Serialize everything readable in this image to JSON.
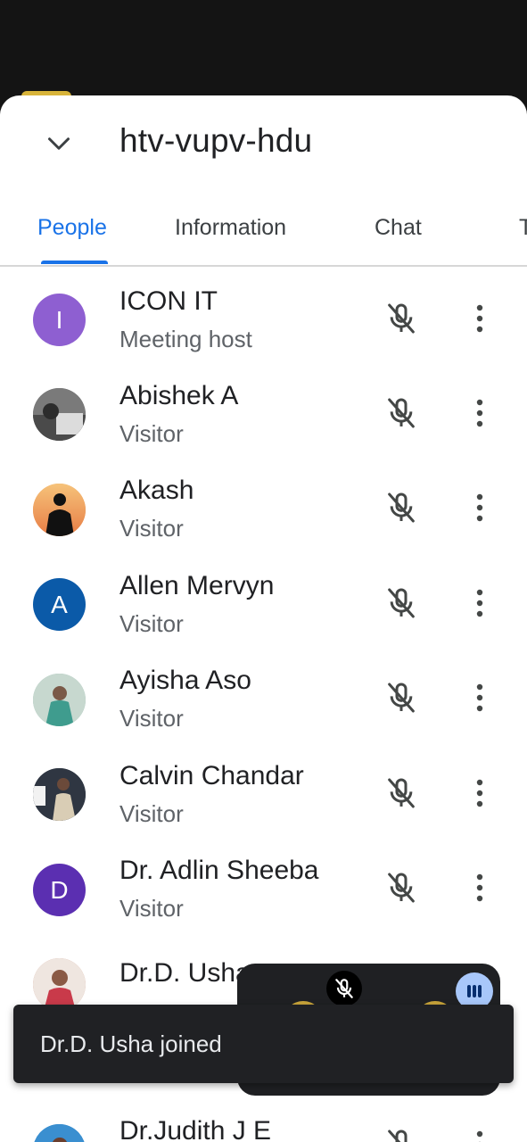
{
  "meeting": {
    "code": "htv-vupv-hdu"
  },
  "tabs": [
    {
      "label": "People",
      "active": true
    },
    {
      "label": "Information",
      "active": false
    },
    {
      "label": "Chat",
      "active": false
    },
    {
      "label": "T",
      "active": false
    }
  ],
  "participants": [
    {
      "name": "ICON IT",
      "role": "Meeting host",
      "avatar": {
        "type": "initial",
        "letter": "I",
        "color": "#8e5fd1"
      },
      "mic": "muted"
    },
    {
      "name": "Abishek A",
      "role": "Visitor",
      "avatar": {
        "type": "photo",
        "color": "#6f6f6f"
      },
      "mic": "muted"
    },
    {
      "name": "Akash",
      "role": "Visitor",
      "avatar": {
        "type": "photo",
        "color": "#f0a35e"
      },
      "mic": "muted"
    },
    {
      "name": "Allen Mervyn",
      "role": "Visitor",
      "avatar": {
        "type": "initial",
        "letter": "A",
        "color": "#0b5aa8"
      },
      "mic": "muted"
    },
    {
      "name": "Ayisha Aso",
      "role": "Visitor",
      "avatar": {
        "type": "photo",
        "color": "#8fb9b0"
      },
      "mic": "muted"
    },
    {
      "name": "Calvin Chandar",
      "role": "Visitor",
      "avatar": {
        "type": "photo",
        "color": "#47505e"
      },
      "mic": "muted"
    },
    {
      "name": "Dr. Adlin Sheeba",
      "role": "Visitor",
      "avatar": {
        "type": "initial",
        "letter": "D",
        "color": "#5b2fb1"
      },
      "mic": "muted"
    },
    {
      "name": "Dr.D. Usha",
      "role": "",
      "avatar": {
        "type": "photo",
        "color": "#c98a78"
      },
      "mic": "muted"
    },
    {
      "name": "Dr.Judith J E",
      "role": "",
      "avatar": {
        "type": "photo",
        "color": "#3a8fd0"
      },
      "mic": "muted"
    }
  ],
  "toast": {
    "message": "Dr.D. Usha joined"
  },
  "colors": {
    "accent": "#1a73e8",
    "text_primary": "#202124",
    "text_secondary": "#5f6368",
    "icon": "#444746"
  }
}
